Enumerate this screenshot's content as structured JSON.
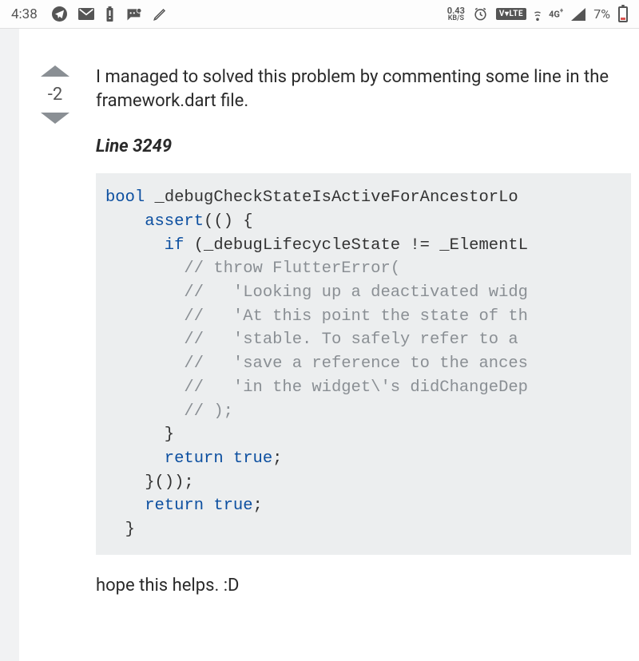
{
  "statusbar": {
    "time": "4:38",
    "data_rate_value": "0.43",
    "data_rate_unit": "KB/S",
    "volte": "V▾LTE",
    "net_gen": "4G",
    "net_sup": "+",
    "battery_pct": "7%"
  },
  "vote": {
    "score": "-2"
  },
  "answer": {
    "intro": "I managed to solved this problem by commenting some line in the framework.dart file.",
    "line_label": "Line 3249",
    "closing": "hope this helps. :D"
  },
  "code": {
    "l1a": "bool",
    "l1b": " _debugCheckStateIsActiveForAncestorLo",
    "l2a": "    assert",
    "l2b": "(() {",
    "l3a": "      if",
    "l3b": " (_debugLifecycleState != _ElementL",
    "l4": "        // throw FlutterError(",
    "l5": "        //   'Looking up a deactivated widg",
    "l6": "        //   'At this point the state of th",
    "l7": "        //   'stable. To safely refer to a ",
    "l8": "        //   'save a reference to the ances",
    "l9": "        //   'in the widget\\'s didChangeDep",
    "l10": "        // );",
    "l11": "      }",
    "l12a": "      return",
    "l12b": " true",
    "l12c": ";",
    "l13": "    }());",
    "l14a": "    return",
    "l14b": " true",
    "l14c": ";",
    "l15": "  }"
  }
}
